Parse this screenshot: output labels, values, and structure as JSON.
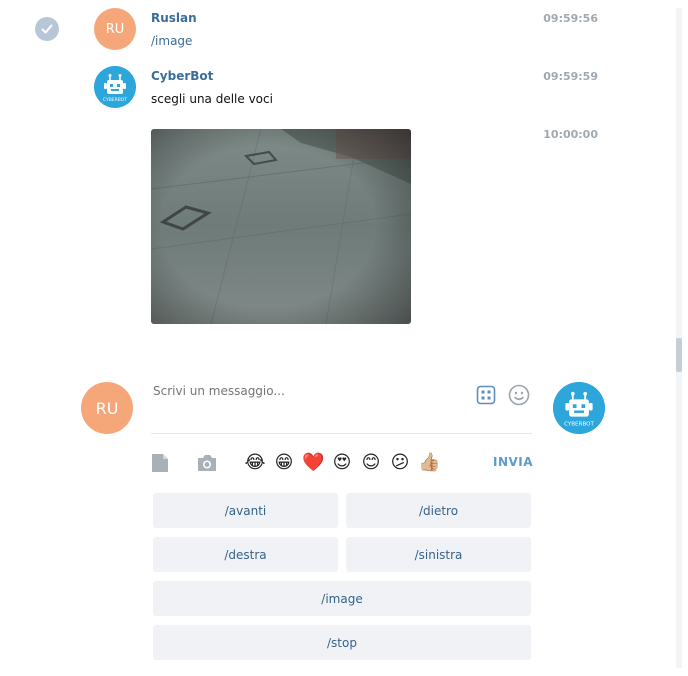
{
  "messages": [
    {
      "author": "Ruslan",
      "text": "/image",
      "time": "09:59:56",
      "avatar_initials": "RU"
    },
    {
      "author": "CyberBot",
      "text": "scegli una delle voci",
      "time": "09:59:59",
      "avatar_label": "CYBERBOT"
    },
    {
      "time": "10:00:00"
    }
  ],
  "composer": {
    "avatar_initials": "RU",
    "placeholder": "Scrivi un messaggio...",
    "send_label": "INVIA",
    "bot_avatar_label": "CYBERBOT",
    "emojis": [
      "😂",
      "😁",
      "❤️",
      "😍",
      "😊",
      "😕",
      "👍🏼"
    ]
  },
  "keyboard": {
    "buttons": [
      "/avanti",
      "/dietro",
      "/destra",
      "/sinistra",
      "/image",
      "/stop"
    ]
  },
  "colors": {
    "accent": "#3a6d99",
    "avatar_user": "#f5a77a",
    "avatar_bot": "#2da6dc",
    "keyboard_bg": "#f0f2f5",
    "time": "#a0a8b0"
  }
}
